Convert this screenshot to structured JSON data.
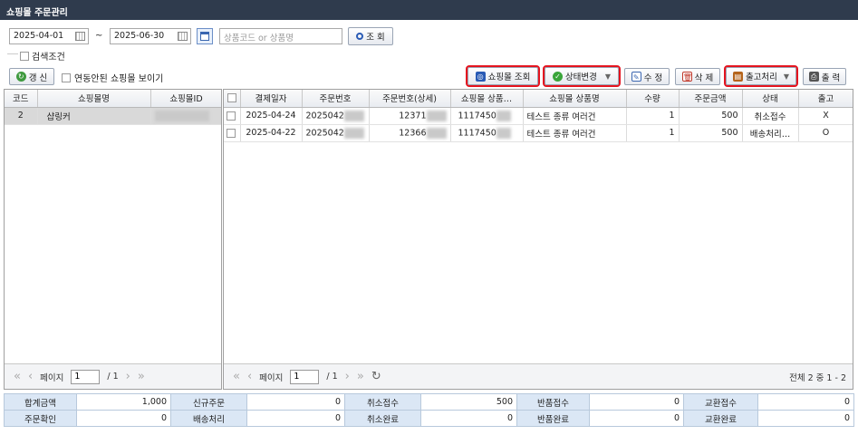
{
  "window": {
    "title": "쇼핑몰 주문관리"
  },
  "filters": {
    "date_from": "2025-04-01",
    "tilde": "~",
    "date_to": "2025-06-30",
    "search_placeholder": "상품코드 or 상품명",
    "search_button": "조 회",
    "search_condition_label": "검색조건"
  },
  "left_toolbar": {
    "refresh_label": "갱 신",
    "show_linked_label": "연동안된 쇼핑몰 보이기"
  },
  "toolbar": {
    "mall_lookup": "쇼핑몰 조회",
    "status_change": "상태변경",
    "edit": "수 정",
    "delete": "삭 제",
    "shipping": "출고처리",
    "print": "출 력"
  },
  "malls": {
    "columns": [
      "코드",
      "쇼핑몰명",
      "쇼핑몰ID"
    ],
    "rows": [
      {
        "code": "2",
        "name": "샵링커",
        "id": ""
      }
    ]
  },
  "orders": {
    "columns": [
      "결제일자",
      "주문번호",
      "주문번호(상세)",
      "쇼핑몰 상품…",
      "쇼핑몰 상품명",
      "수량",
      "주문금액",
      "상태",
      "출고"
    ],
    "rows": [
      {
        "date": "2025-04-24",
        "order_no": "2025042",
        "order_detail": "12371",
        "mall_product": "1117450",
        "product_name": "테스트 종류 여러건",
        "qty": "1",
        "amount": "500",
        "status": "취소접수",
        "shipped": "X"
      },
      {
        "date": "2025-04-22",
        "order_no": "2025042",
        "order_detail": "12366",
        "mall_product": "1117450",
        "product_name": "테스트 종류 여러건",
        "qty": "1",
        "amount": "500",
        "status": "배송처리…",
        "shipped": "O"
      }
    ]
  },
  "pager_left": {
    "page_label": "페이지",
    "page": "1",
    "total_pages": "/ 1"
  },
  "pager_right": {
    "page_label": "페이지",
    "page": "1",
    "total_pages": "/ 1",
    "summary": "전체 2 중 1 - 2"
  },
  "summary": {
    "row1": [
      {
        "label": "합계금액",
        "value": "1,000"
      },
      {
        "label": "신규주문",
        "value": "0"
      },
      {
        "label": "취소접수",
        "value": "500"
      },
      {
        "label": "반품접수",
        "value": "0"
      },
      {
        "label": "교환접수",
        "value": "0"
      }
    ],
    "row2": [
      {
        "label": "주문확인",
        "value": "0"
      },
      {
        "label": "배송처리",
        "value": "0"
      },
      {
        "label": "취소완료",
        "value": "0"
      },
      {
        "label": "반품완료",
        "value": "0"
      },
      {
        "label": "교환완료",
        "value": "0"
      }
    ]
  },
  "colors": {
    "titlebar": "#2f3b4d",
    "highlight": "#e5141f",
    "summary_label": "#dbe7f5",
    "selected_row": "#d9d9d9"
  }
}
